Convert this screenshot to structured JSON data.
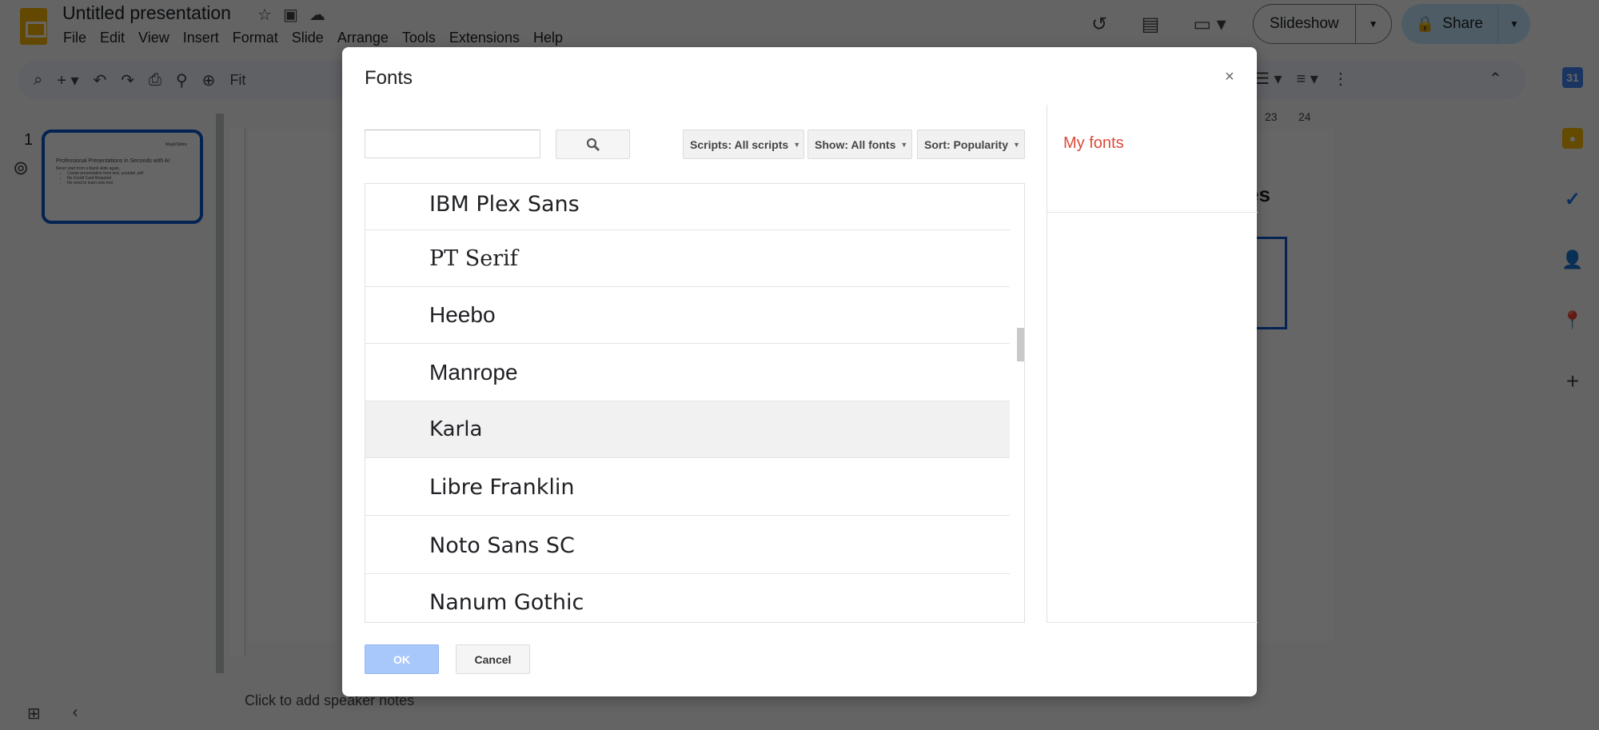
{
  "app": {
    "doc_title": "Untitled presentation",
    "menu": [
      "File",
      "Edit",
      "View",
      "Insert",
      "Format",
      "Slide",
      "Arrange",
      "Tools",
      "Extensions",
      "Help"
    ],
    "slideshow_label": "Slideshow",
    "share_label": "Share",
    "zoom_label": "Fit",
    "slide_number": "1",
    "thumbnail": {
      "brand": "MagicSlides",
      "title": "Professional Presentations in Seconds with AI",
      "subtitle": "Never start from a blank slide again.",
      "bullets": [
        "Create presentation from text, youtube, pdf",
        "No Credit Card Required",
        "No need to learn new tool"
      ]
    },
    "ruler_ticks": [
      "23",
      "24"
    ],
    "slide_peek_text": "es",
    "speaker_notes_placeholder": "Click to add speaker notes",
    "side_panel": {
      "calendar_label": "31"
    }
  },
  "dialog": {
    "title": "Fonts",
    "close_label": "×",
    "search": {
      "value": "",
      "placeholder": ""
    },
    "filters": {
      "scripts": "Scripts: All scripts",
      "show": "Show: All fonts",
      "sort": "Sort: Popularity"
    },
    "fonts": [
      "IBM Plex Sans",
      "PT Serif",
      "Heebo",
      "Manrope",
      "Karla",
      "Libre Franklin",
      "Noto Sans SC",
      "Nanum Gothic"
    ],
    "highlighted_font": "Karla",
    "my_fonts_title": "My fonts",
    "ok_label": "OK",
    "cancel_label": "Cancel"
  }
}
